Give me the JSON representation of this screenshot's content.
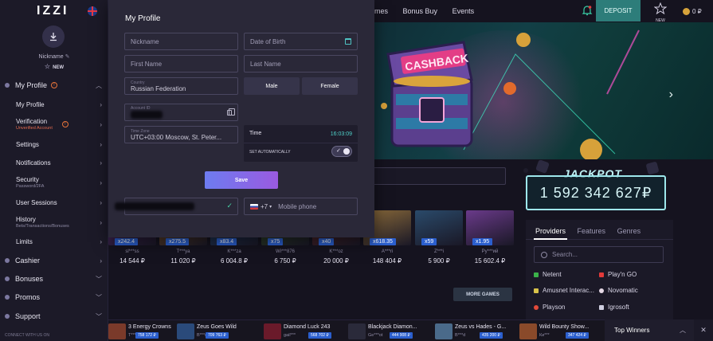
{
  "sidebar": {
    "logo": "IZZI",
    "nickname": "Nickname",
    "new_badge": "NEW",
    "items": [
      {
        "label": "My Profile"
      },
      {
        "label": "My Profile"
      },
      {
        "label": "Verification",
        "sub": "Unverified Account"
      },
      {
        "label": "Settings"
      },
      {
        "label": "Notifications"
      },
      {
        "label": "Security",
        "sub": "Password/2FA"
      },
      {
        "label": "User Sessions"
      },
      {
        "label": "History",
        "sub": "Bets/Transactions/Bonuses"
      },
      {
        "label": "Limits"
      },
      {
        "label": "Cashier"
      },
      {
        "label": "Bonuses"
      },
      {
        "label": "Promos"
      },
      {
        "label": "Support"
      }
    ],
    "connect": "CONNECT WITH US ON"
  },
  "header": {
    "nav": [
      "mes",
      "Bonus Buy",
      "Events"
    ],
    "deposit": "DEPOSIT",
    "new_label": "NEW",
    "balance": "0 ₽"
  },
  "hero": {
    "banner_text": "CASHBACK"
  },
  "jackpot": {
    "title": "JACKPOT",
    "amount": "1 592 342 627₽"
  },
  "modal": {
    "title": "My Profile",
    "nickname_placeholder": "Nickname",
    "dob_placeholder": "Date of Birth",
    "first_name_placeholder": "First Name",
    "last_name_placeholder": "Last Name",
    "country_label": "Country",
    "country_value": "Russian Federation",
    "male": "Male",
    "female": "Female",
    "account_id_label": "Account ID",
    "timezone_label": "Time Zone",
    "timezone_value": "UTC+03:00 Moscow, St. Peter...",
    "time_label": "Time",
    "time_value": "16:03:09",
    "set_auto": "SET AUTOMATICALLY",
    "save": "Save",
    "phone_code": "+7",
    "phone_placeholder": "Mobile phone"
  },
  "providers": {
    "tabs": [
      "Providers",
      "Features",
      "Genres"
    ],
    "search_placeholder": "Search...",
    "items": [
      "Netent",
      "Play'n GO",
      "Amusnet Interac...",
      "Novomatic",
      "Playson",
      "Igrosoft"
    ]
  },
  "more_games": "MORE GAMES",
  "tiles": [
    {
      "mult": "x242.4",
      "user": "sl***ss",
      "amount": "14 544 ₽"
    },
    {
      "mult": "x275.5",
      "user": "T***ya",
      "amount": "11 020 ₽"
    },
    {
      "mult": "x83.4",
      "user": "K***za",
      "amount": "6 004.8 ₽"
    },
    {
      "mult": "x75",
      "user": "Wi***876",
      "amount": "6 750 ₽"
    },
    {
      "mult": "x40",
      "user": "K***oz",
      "amount": "20 000 ₽"
    },
    {
      "mult": "x618.35",
      "user": "A***ri",
      "amount": "148 404 ₽"
    },
    {
      "mult": "x59",
      "user": "Z***i",
      "amount": "5 900 ₽"
    },
    {
      "mult": "x1.95",
      "user": "Py***ий",
      "amount": "15 602.4 ₽"
    }
  ],
  "ticker": [
    {
      "name": "3 Energy Crowns",
      "user": "T***",
      "amount": "758 172 ₽"
    },
    {
      "name": "Zeus Goes Wild",
      "user": "B***d",
      "amount": "709 763 ₽"
    },
    {
      "name": "Diamond Luck 243",
      "user": "gail***",
      "amount": "568 702 ₽"
    },
    {
      "name": "Blackjack Diamon...",
      "user": "Ge***ot",
      "amount": "444 908 ₽"
    },
    {
      "name": "Zeus vs Hades - G...",
      "user": "B***d",
      "amount": "435 200 ₽"
    },
    {
      "name": "Wild Bounty Show...",
      "user": "Ки***",
      "amount": "347 424 ₽"
    }
  ],
  "top_winners": "Top Winners",
  "colors": {
    "accent_teal": "#2d7d7a",
    "multiplier_blue": "#2b5fce",
    "jackpot_cyan": "#9ee8ec"
  }
}
